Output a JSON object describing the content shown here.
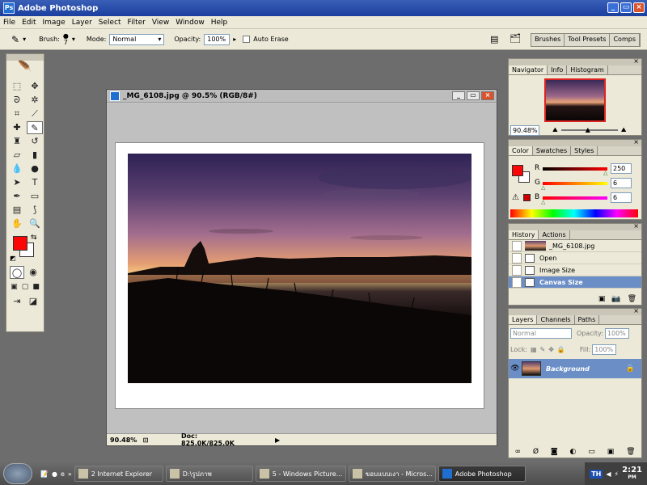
{
  "app": {
    "title": "Adobe Photoshop"
  },
  "menu": [
    "File",
    "Edit",
    "Image",
    "Layer",
    "Select",
    "Filter",
    "View",
    "Window",
    "Help"
  ],
  "options": {
    "brush_label": "Brush:",
    "brush_size": "7",
    "mode_label": "Mode:",
    "mode_value": "Normal",
    "opacity_label": "Opacity:",
    "opacity_value": "100%",
    "auto_erase": "Auto Erase",
    "well_tabs": [
      "Brushes",
      "Tool Presets",
      "Comps"
    ]
  },
  "document": {
    "title": "_MG_6108.jpg @ 90.5% (RGB/8#)",
    "zoom": "90.48%",
    "doc_info": "Doc: 825.0K/825.0K"
  },
  "navigator": {
    "tabs": [
      "Navigator",
      "Info",
      "Histogram"
    ],
    "zoom": "90.48%"
  },
  "color": {
    "tabs": [
      "Color",
      "Swatches",
      "Styles"
    ],
    "r_label": "R",
    "g_label": "G",
    "b_label": "B",
    "r": "250",
    "g": "6",
    "b": "6",
    "foreground": "#fa0606"
  },
  "history": {
    "tabs": [
      "History",
      "Actions"
    ],
    "snapshot": "_MG_6108.jpg",
    "items": [
      "Open",
      "Image Size",
      "Canvas Size"
    ]
  },
  "layers": {
    "tabs": [
      "Layers",
      "Channels",
      "Paths"
    ],
    "blend": "Normal",
    "opacity_label": "Opacity:",
    "opacity": "100%",
    "lock_label": "Lock:",
    "fill_label": "Fill:",
    "fill": "100%",
    "layer_name": "Background"
  },
  "taskbar": {
    "items": [
      "2 Internet Explorer",
      "D:\\รูปภาพ",
      "5 - Windows Picture...",
      "ขอบแบบเงา - Micros...",
      "Adobe Photoshop"
    ],
    "tray_lang": "TH",
    "time": "2:21",
    "ampm": "PM"
  }
}
